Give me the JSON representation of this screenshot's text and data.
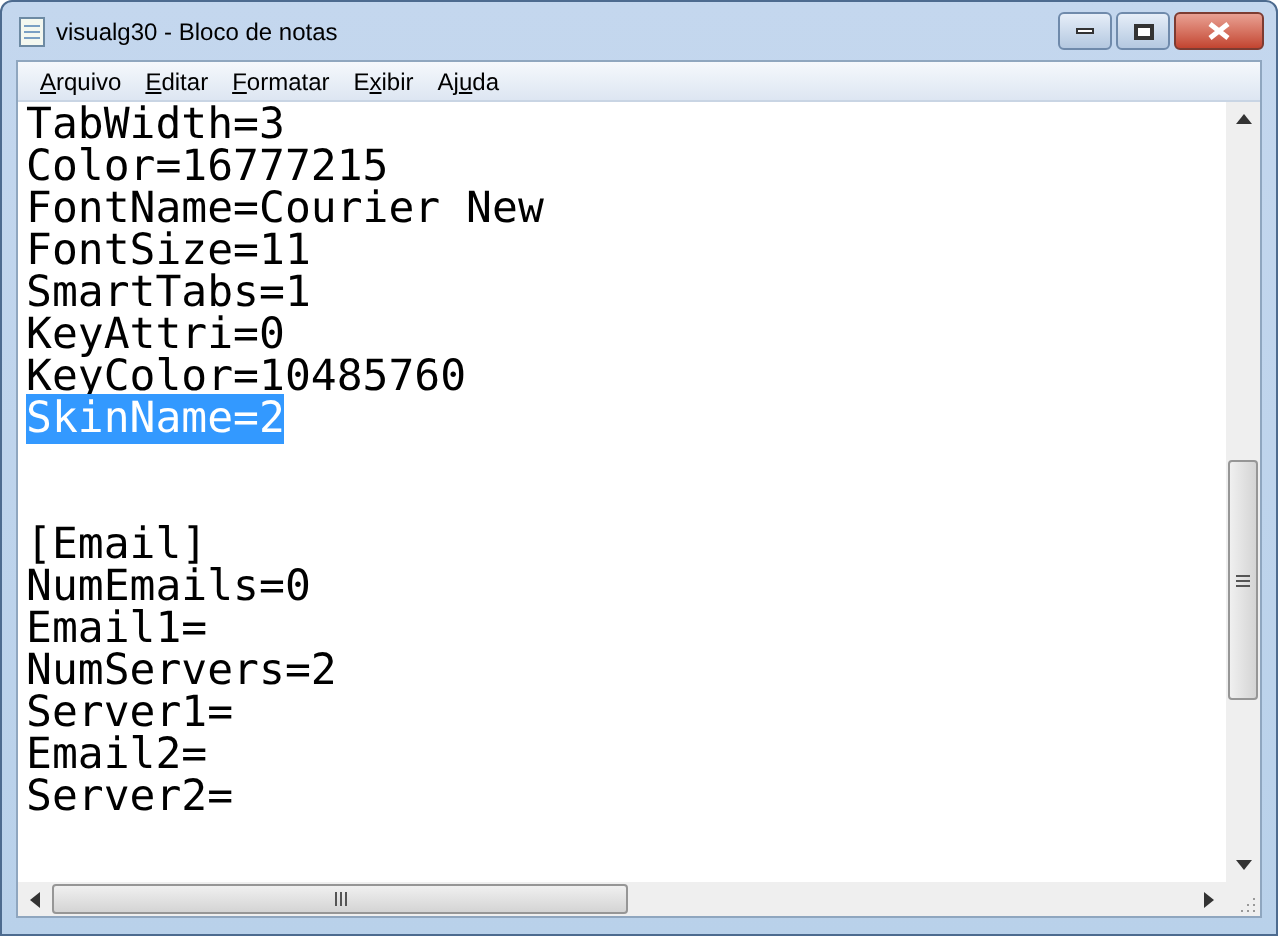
{
  "window": {
    "title": "visualg30 - Bloco de notas"
  },
  "menu": [
    {
      "key": "A",
      "after": "rquivo"
    },
    {
      "key": "E",
      "after": "ditar"
    },
    {
      "key": "F",
      "after": "ormatar"
    },
    {
      "before": "E",
      "key": "x",
      "after": "ibir"
    },
    {
      "before": "Aj",
      "key": "u",
      "after": "da"
    }
  ],
  "lines": [
    {
      "kind": "text",
      "text": "TabWidth=3",
      "selected": false
    },
    {
      "kind": "text",
      "text": "Color=16777215",
      "selected": false
    },
    {
      "kind": "text",
      "text": "FontName=Courier New",
      "selected": false
    },
    {
      "kind": "text",
      "text": "FontSize=11",
      "selected": false
    },
    {
      "kind": "text",
      "text": "SmartTabs=1",
      "selected": false
    },
    {
      "kind": "text",
      "text": "KeyAttri=0",
      "selected": false
    },
    {
      "kind": "text",
      "text": "KeyColor=10485760",
      "selected": false
    },
    {
      "kind": "text",
      "text": "SkinName=2",
      "selected": true
    },
    {
      "kind": "blank"
    },
    {
      "kind": "blank"
    },
    {
      "kind": "text",
      "text": "[Email]",
      "selected": false
    },
    {
      "kind": "text",
      "text": "NumEmails=0",
      "selected": false
    },
    {
      "kind": "text",
      "text": "Email1=",
      "selected": false
    },
    {
      "kind": "text",
      "text": "NumServers=2",
      "selected": false
    },
    {
      "kind": "text",
      "text": "Server1=",
      "selected": false
    },
    {
      "kind": "text",
      "text": "Email2=",
      "selected": false
    },
    {
      "kind": "text",
      "text": "Server2=",
      "selected": false
    }
  ]
}
